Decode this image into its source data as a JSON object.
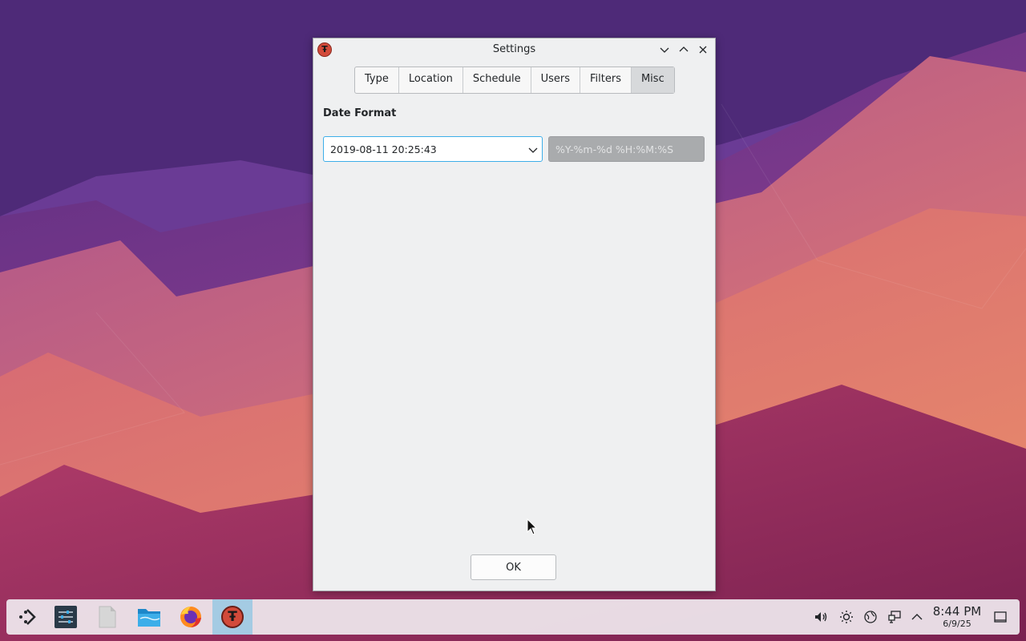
{
  "window": {
    "title": "Settings",
    "app_icon_glyph": "Ŧ"
  },
  "tabs": [
    {
      "label": "Type"
    },
    {
      "label": "Location"
    },
    {
      "label": "Schedule"
    },
    {
      "label": "Users"
    },
    {
      "label": "Filters"
    },
    {
      "label": "Misc",
      "active": true
    }
  ],
  "date_format": {
    "section_label": "Date Format",
    "selected": "2019-08-11 20:25:43",
    "format_placeholder": "%Y-%m-%d %H:%M:%S"
  },
  "buttons": {
    "ok": "OK"
  },
  "taskbar": {
    "clock_time": "8:44 PM",
    "clock_date": "6/9/25"
  },
  "colors": {
    "accent": "#3daee9",
    "taskbar_active": "#a4cbe3",
    "app_icon": "#d24a3a"
  }
}
